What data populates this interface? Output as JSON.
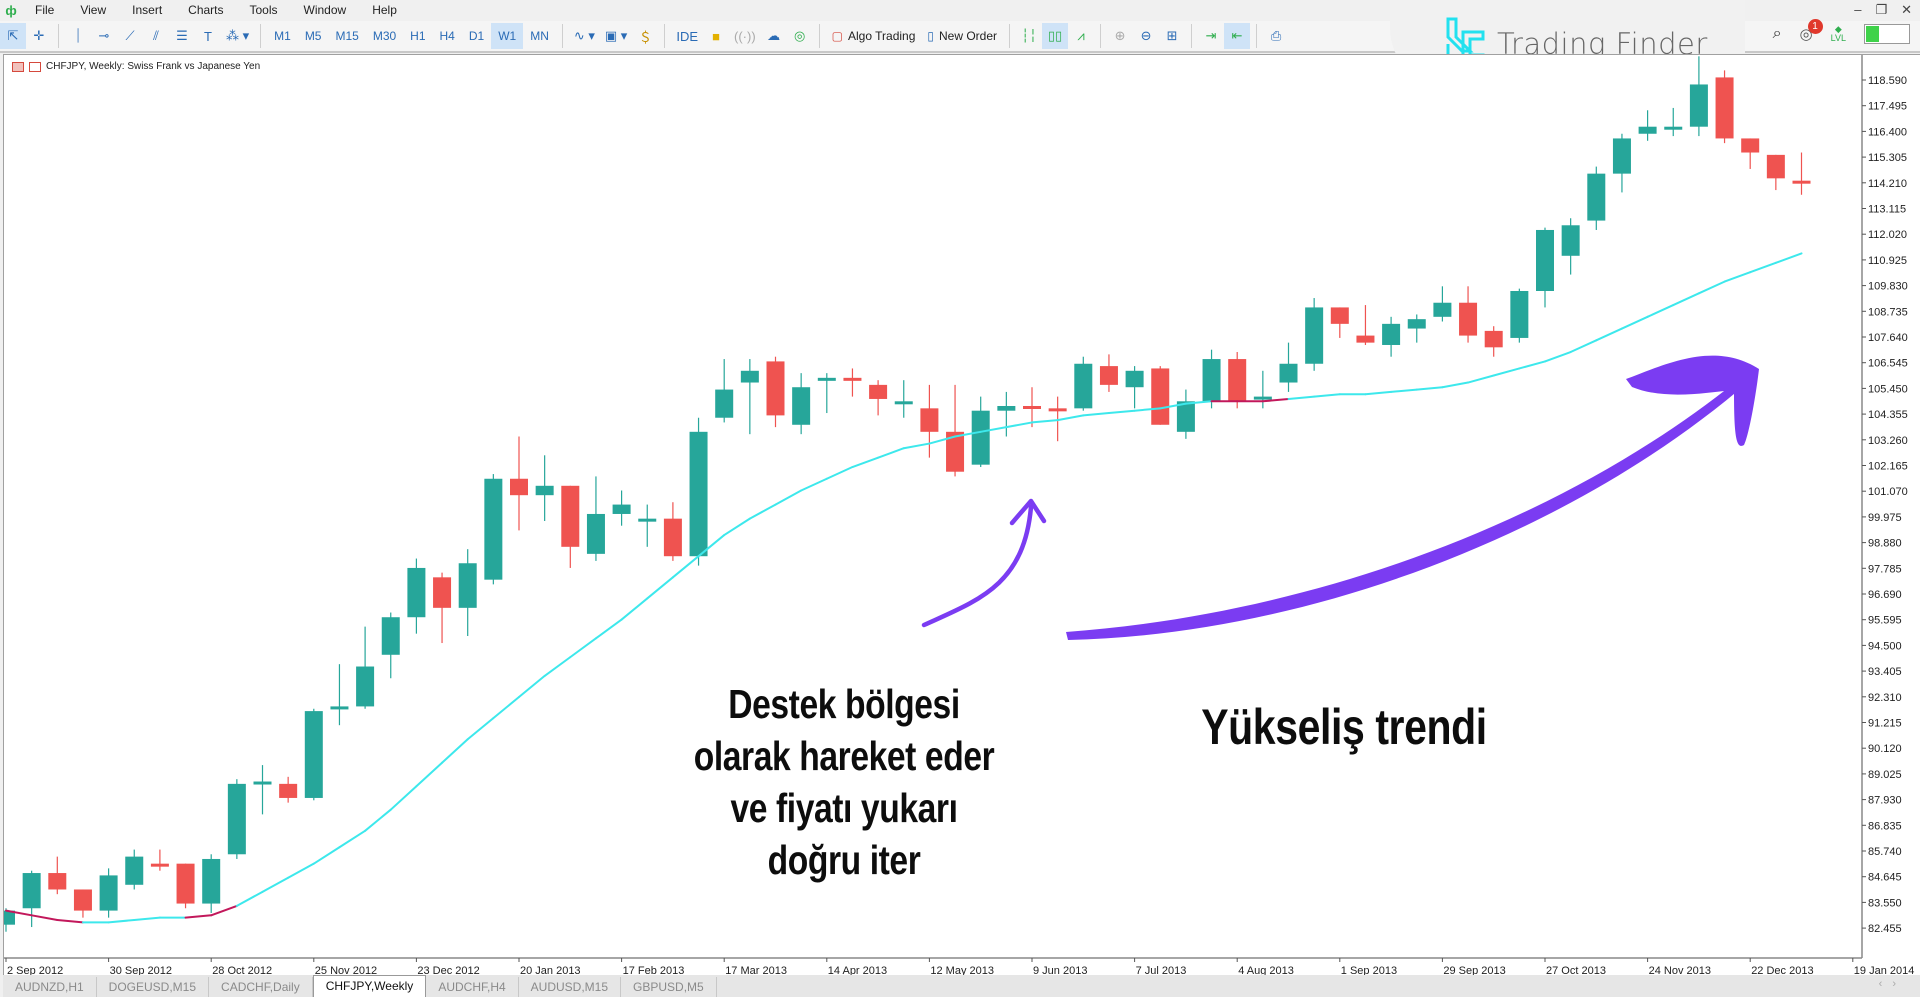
{
  "menu": {
    "items": [
      "File",
      "View",
      "Insert",
      "Charts",
      "Tools",
      "Window",
      "Help"
    ]
  },
  "toolbar": {
    "timeframes": [
      "M1",
      "M5",
      "M15",
      "M30",
      "H1",
      "H4",
      "D1",
      "W1",
      "MN"
    ],
    "active_timeframe": "W1",
    "ide_label": "IDE",
    "algo_trading_label": "Algo Trading",
    "new_order_label": "New Order",
    "notification_count": "1",
    "level_label": "LVL",
    "level_progress": 0.3
  },
  "logo": {
    "text": "Trading Finder",
    "color": "#22e1ef"
  },
  "chart": {
    "title": "CHFJPY, Weekly:  Swiss Frank vs Japanese Yen",
    "bull_color": "#26a69a",
    "bear_color": "#ef5350",
    "ma_color": "#3de8ec",
    "ma_down_color": "#c2185b",
    "arrow_color": "#7b3cf2"
  },
  "annotations": {
    "support_lines": [
      "Destek bölgesi",
      "olarak hareket eder",
      "ve fiyatı yukarı",
      "doğru iter"
    ],
    "trend_label": "Yükseliş trendi"
  },
  "tabs": [
    "AUDNZD,H1",
    "DOGEUSD,M15",
    "CADCHF,Daily",
    "CHFJPY,Weekly",
    "AUDCHF,H4",
    "AUDUSD,M15",
    "GBPUSD,M5"
  ],
  "active_tab": "CHFJPY,Weekly",
  "chart_data": {
    "type": "candlestick",
    "title": "CHFJPY, Weekly:  Swiss Frank vs Japanese Yen",
    "ylim": [
      81.9,
      119.6
    ],
    "price_ticks": [
      "118.590",
      "117.495",
      "116.400",
      "115.305",
      "114.210",
      "113.115",
      "112.020",
      "110.925",
      "109.830",
      "108.735",
      "107.640",
      "106.545",
      "105.450",
      "104.355",
      "103.260",
      "102.165",
      "101.070",
      "99.975",
      "98.880",
      "97.785",
      "96.690",
      "95.595",
      "94.500",
      "93.405",
      "92.310",
      "91.215",
      "90.120",
      "89.025",
      "87.930",
      "86.835",
      "85.740",
      "84.645",
      "83.550",
      "82.455"
    ],
    "date_ticks": [
      "2 Sep 2012",
      "30 Sep 2012",
      "28 Oct 2012",
      "25 Nov 2012",
      "23 Dec 2012",
      "20 Jan 2013",
      "17 Feb 2013",
      "17 Mar 2013",
      "14 Apr 2013",
      "12 May 2013",
      "9 Jun 2013",
      "7 Jul 2013",
      "4 Aug 2013",
      "1 Sep 2013",
      "29 Sep 2013",
      "27 Oct 2013",
      "24 Nov 2013",
      "22 Dec 2013",
      "19 Jan 2014"
    ],
    "candles": [
      [
        82.6,
        83.2,
        82.3,
        83.3
      ],
      [
        83.3,
        84.8,
        82.5,
        84.9
      ],
      [
        84.8,
        84.1,
        83.9,
        85.5
      ],
      [
        84.1,
        83.2,
        82.9,
        84.1
      ],
      [
        83.2,
        84.7,
        82.9,
        85.0
      ],
      [
        84.3,
        85.5,
        84.1,
        85.8
      ],
      [
        85.2,
        85.1,
        84.9,
        85.8
      ],
      [
        85.2,
        83.5,
        83.3,
        85.2
      ],
      [
        83.5,
        85.4,
        83.1,
        85.6
      ],
      [
        85.6,
        88.6,
        85.4,
        88.8
      ],
      [
        88.6,
        88.7,
        87.3,
        89.4
      ],
      [
        88.6,
        88.0,
        87.8,
        88.9
      ],
      [
        88.0,
        91.7,
        87.9,
        91.8
      ],
      [
        91.8,
        91.9,
        91.1,
        93.7
      ],
      [
        91.9,
        93.6,
        91.8,
        95.3
      ],
      [
        94.1,
        95.7,
        93.1,
        95.9
      ],
      [
        95.7,
        97.8,
        95.0,
        98.2
      ],
      [
        97.4,
        96.1,
        94.6,
        97.6
      ],
      [
        96.1,
        98.0,
        94.9,
        98.6
      ],
      [
        97.3,
        101.6,
        97.1,
        101.8
      ],
      [
        101.6,
        100.9,
        99.4,
        103.4
      ],
      [
        100.9,
        101.3,
        99.8,
        102.6
      ],
      [
        101.3,
        98.7,
        97.8,
        101.3
      ],
      [
        98.4,
        100.1,
        98.1,
        101.7
      ],
      [
        100.1,
        100.5,
        99.6,
        101.1
      ],
      [
        99.9,
        99.9,
        98.7,
        100.5
      ],
      [
        99.9,
        98.3,
        98.1,
        100.6
      ],
      [
        98.3,
        103.6,
        97.9,
        104.2
      ],
      [
        104.2,
        105.4,
        104.0,
        106.7
      ],
      [
        105.7,
        106.2,
        103.5,
        106.7
      ],
      [
        106.6,
        104.3,
        103.8,
        106.8
      ],
      [
        103.9,
        105.5,
        103.5,
        106.1
      ],
      [
        105.8,
        105.9,
        104.4,
        106.1
      ],
      [
        105.9,
        105.8,
        105.1,
        106.3
      ],
      [
        105.6,
        105.0,
        104.3,
        105.8
      ],
      [
        104.9,
        104.9,
        104.2,
        105.8
      ],
      [
        104.6,
        103.6,
        102.5,
        105.6
      ],
      [
        103.6,
        101.9,
        101.7,
        105.6
      ],
      [
        102.2,
        104.5,
        102.1,
        105.1
      ],
      [
        104.5,
        104.7,
        103.4,
        105.3
      ],
      [
        104.7,
        104.6,
        103.8,
        105.5
      ],
      [
        104.6,
        104.5,
        103.2,
        105.1
      ],
      [
        104.6,
        106.5,
        104.5,
        106.8
      ],
      [
        106.4,
        105.6,
        105.3,
        106.9
      ],
      [
        105.5,
        106.2,
        104.6,
        106.4
      ],
      [
        106.3,
        103.9,
        103.9,
        106.4
      ],
      [
        103.6,
        104.9,
        103.3,
        105.4
      ],
      [
        104.9,
        106.7,
        104.6,
        107.1
      ],
      [
        106.7,
        104.9,
        104.6,
        107.0
      ],
      [
        105.0,
        105.1,
        104.6,
        106.2
      ],
      [
        105.7,
        106.5,
        105.3,
        107.4
      ],
      [
        106.5,
        108.9,
        106.2,
        109.3
      ],
      [
        108.9,
        108.2,
        107.6,
        108.9
      ],
      [
        107.7,
        107.4,
        107.3,
        109.0
      ],
      [
        107.3,
        108.2,
        106.8,
        108.5
      ],
      [
        108.0,
        108.4,
        107.4,
        108.6
      ],
      [
        108.5,
        109.1,
        108.3,
        109.8
      ],
      [
        109.1,
        107.7,
        107.4,
        109.8
      ],
      [
        107.9,
        107.2,
        106.8,
        108.1
      ],
      [
        107.6,
        109.6,
        107.4,
        109.7
      ],
      [
        109.6,
        112.2,
        108.9,
        112.3
      ],
      [
        111.1,
        112.4,
        110.3,
        112.7
      ],
      [
        112.6,
        114.6,
        112.2,
        114.9
      ],
      [
        114.6,
        116.1,
        113.8,
        116.3
      ],
      [
        116.3,
        116.6,
        116.0,
        117.3
      ],
      [
        116.5,
        116.6,
        116.2,
        117.4
      ],
      [
        116.6,
        118.4,
        116.2,
        119.6
      ],
      [
        118.7,
        116.1,
        115.9,
        119.0
      ],
      [
        116.1,
        115.5,
        114.8,
        116.1
      ],
      [
        115.4,
        114.4,
        113.9,
        115.4
      ],
      [
        114.3,
        114.2,
        113.7,
        115.5
      ]
    ],
    "moving_average": [
      83.2,
      83.0,
      82.8,
      82.7,
      82.7,
      82.8,
      82.9,
      82.9,
      83.0,
      83.4,
      84.0,
      84.6,
      85.2,
      85.9,
      86.6,
      87.5,
      88.5,
      89.5,
      90.5,
      91.4,
      92.3,
      93.2,
      94.0,
      94.8,
      95.6,
      96.5,
      97.4,
      98.3,
      99.2,
      99.9,
      100.5,
      101.1,
      101.6,
      102.1,
      102.5,
      102.9,
      103.1,
      103.4,
      103.6,
      103.8,
      104.0,
      104.1,
      104.3,
      104.4,
      104.5,
      104.6,
      104.8,
      104.9,
      104.9,
      104.9,
      105.0,
      105.1,
      105.2,
      105.2,
      105.3,
      105.4,
      105.5,
      105.7,
      106.0,
      106.3,
      106.6,
      107.0,
      107.5,
      108.0,
      108.5,
      109.0,
      109.5,
      110.0,
      110.4,
      110.8,
      111.2
    ],
    "ma_down_segments": [
      [
        0,
        3
      ],
      [
        7,
        9
      ],
      [
        47,
        50
      ]
    ]
  }
}
